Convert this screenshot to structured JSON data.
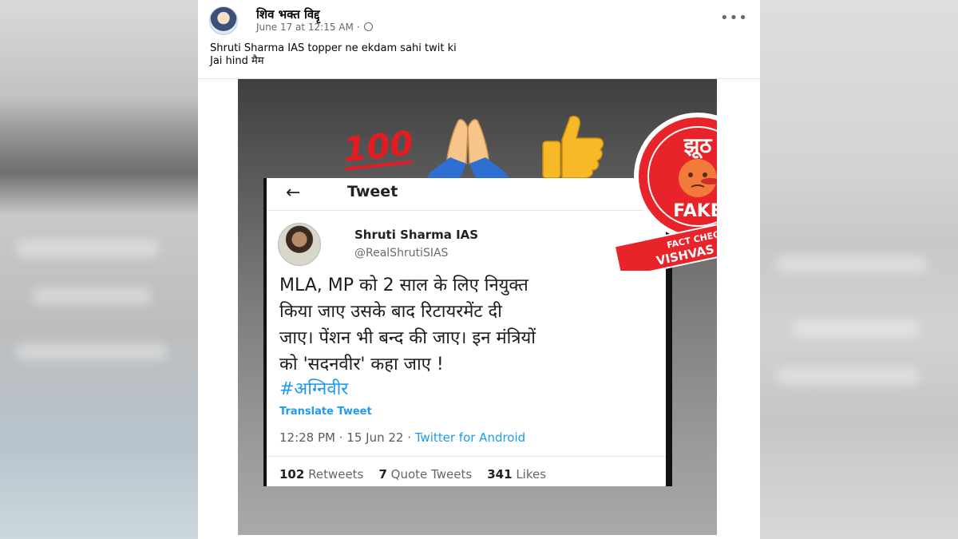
{
  "post": {
    "author": "शिव भक्त विद्दृ",
    "date": "June 17 at 12:15 AM",
    "caption_line1": "Shruti Sharma IAS topper ne ekdam sahi twit ki",
    "caption_line2": "Jai hind मैम",
    "more": "•••"
  },
  "image": {
    "emoji_100": "100",
    "tweet": {
      "header": "Tweet",
      "back": "←",
      "name": "Shruti Sharma IAS",
      "handle": "@RealShrutiSIAS",
      "text_lines": [
        "MLA, MP को 2 साल के लिए नियुक्त",
        "किया जाए उसके बाद रिटायरमेंट दी",
        "जाए। पेंशन भी बन्द की जाए। इन मंत्रियों",
        "को 'सदनवीर' कहा जाए !"
      ],
      "hashtag": "#अग्निवीर",
      "translate": "Translate Tweet",
      "time": "12:28 PM · 15 Jun 22 · ",
      "source": "Twitter for Android",
      "retweets": "102",
      "retweets_label": "Retweets",
      "quotes": "7",
      "quotes_label": "Quote Tweets",
      "likes": "341",
      "likes_label": "Likes"
    },
    "stamp": {
      "top": "झूठ",
      "fake": "FAKE",
      "line1": "FACT CHECK BY",
      "line2": "VISHVAS NEWS"
    }
  },
  "colors": {
    "stamp_red": "#e8232a",
    "link_blue": "#1d9bf0"
  }
}
